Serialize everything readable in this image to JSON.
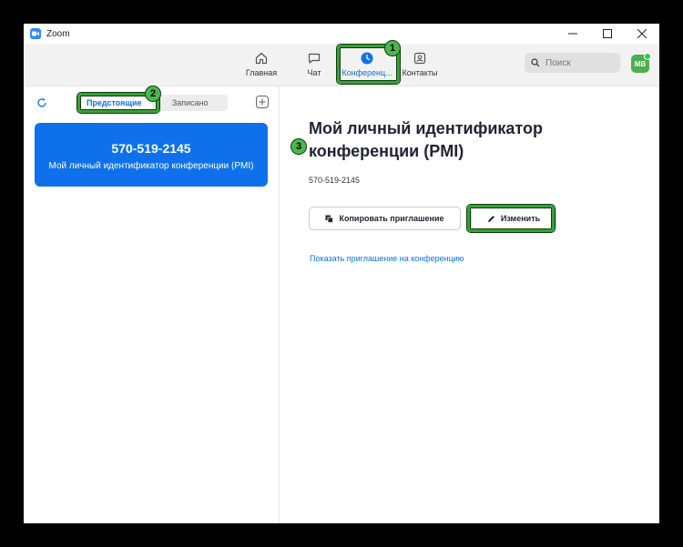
{
  "window": {
    "title": "Zoom"
  },
  "nav": {
    "tabs": [
      {
        "label": "Главная",
        "icon": "home-icon"
      },
      {
        "label": "Чат",
        "icon": "chat-icon"
      },
      {
        "label": "Конференц...",
        "icon": "clock-icon",
        "active": true
      },
      {
        "label": "Контакты",
        "icon": "contacts-icon"
      }
    ],
    "search_placeholder": "Поиск",
    "avatar_initials": "МВ"
  },
  "sidebar": {
    "segments": [
      "Предстоящие",
      "Записано"
    ],
    "meeting_card": {
      "number": "570-519-2145",
      "label": "Мой личный идентификатор конференции (PMI)"
    }
  },
  "main": {
    "title": "Мой личный идентификатор конференции (PMI)",
    "id": "570-519-2145",
    "copy_button": "Копировать приглашение",
    "edit_button": "Изменить",
    "show_link": "Показать приглашение на конференцию"
  },
  "annotations": [
    "1",
    "2",
    "3"
  ],
  "colors": {
    "accent": "#0e71eb",
    "highlight": "#3a9f3a",
    "avatar": "#4caf50"
  }
}
